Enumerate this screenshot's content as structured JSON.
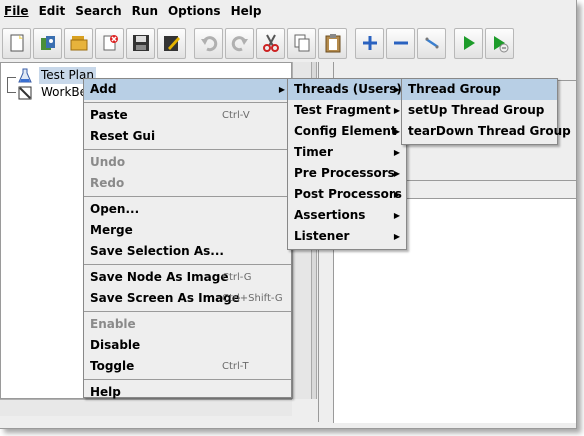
{
  "menubar": [
    "File",
    "Edit",
    "Search",
    "Run",
    "Options",
    "Help"
  ],
  "toolbar": {
    "icons": [
      "new-icon",
      "templates-icon",
      "open-icon",
      "close-icon",
      "save-icon",
      "edit-icon",
      "undo-icon",
      "redo-icon",
      "cut-icon",
      "copy-icon",
      "paste-icon",
      "expand-icon",
      "collapse-icon",
      "toggle-icon",
      "start-icon",
      "start-no-pause-icon"
    ]
  },
  "tree": {
    "test_plan": "Test Plan",
    "workbench": "WorkBe"
  },
  "context_menu": {
    "add": "Add",
    "paste": "Paste",
    "paste_sc": "Ctrl-V",
    "reset_gui": "Reset Gui",
    "undo": "Undo",
    "redo": "Redo",
    "open": "Open...",
    "merge": "Merge",
    "save_selection": "Save Selection As...",
    "save_node_image": "Save Node As Image",
    "save_node_image_sc": "Ctrl-G",
    "save_screen_image": "Save Screen As Image",
    "save_screen_image_sc": "Ctrl+Shift-G",
    "enable": "Enable",
    "disable": "Disable",
    "toggle": "Toggle",
    "toggle_sc": "Ctrl-T",
    "help": "Help"
  },
  "add_menu": {
    "threads": "Threads (Users)",
    "test_fragment": "Test Fragment",
    "config_element": "Config Element",
    "timer": "Timer",
    "pre_processors": "Pre Processors",
    "post_processors": "Post Processors",
    "assertions": "Assertions",
    "listener": "Listener"
  },
  "threads_menu": {
    "thread_group": "Thread Group",
    "setup_thread_group": "setUp Thread Group",
    "teardown_thread_group": "tearDown Thread Group"
  },
  "colors": {
    "highlight": "#b8cfe5",
    "menu_bg": "#eeeeee",
    "disabled": "#8a8a8a"
  }
}
